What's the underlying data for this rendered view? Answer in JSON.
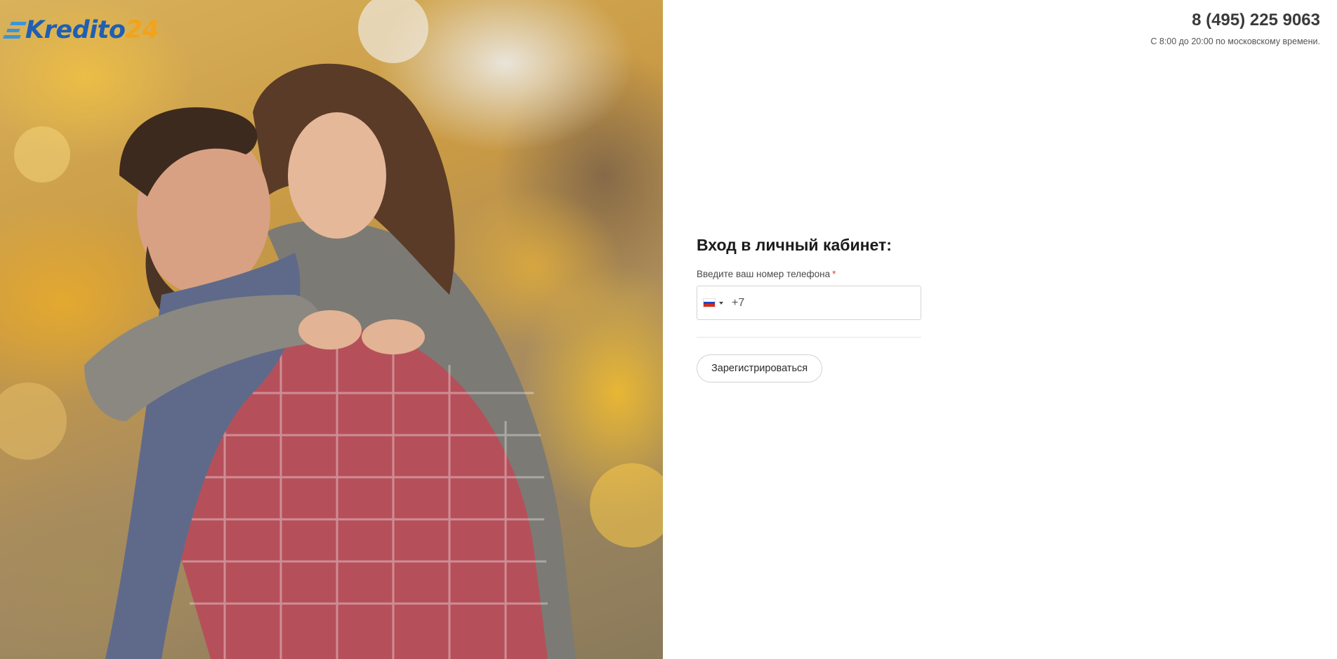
{
  "logo": {
    "word": "Kredito",
    "number": "24"
  },
  "contact": {
    "phone": "8 (495) 225 9063",
    "hours": "С 8:00 до 20:00 по московскому времени."
  },
  "login": {
    "title": "Вход в личный кабинет:",
    "phone_label": "Введите ваш номер телефона",
    "required_mark": "*",
    "country": "RU",
    "phone_prefix": "+7",
    "register_label": "Зарегистрироваться"
  },
  "colors": {
    "brand_blue": "#1f5fb4",
    "brand_orange": "#f2a31b",
    "required": "#e2433b"
  }
}
